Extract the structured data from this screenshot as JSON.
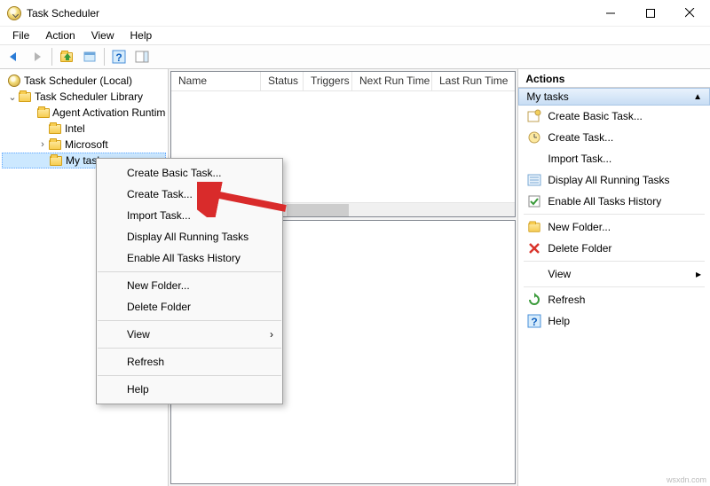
{
  "window": {
    "title": "Task Scheduler"
  },
  "menu": {
    "file": "File",
    "action": "Action",
    "view": "View",
    "help": "Help"
  },
  "tree": {
    "root": "Task Scheduler (Local)",
    "library": "Task Scheduler Library",
    "items": [
      "Agent Activation Runtime",
      "Intel",
      "Microsoft",
      "My tasks"
    ]
  },
  "list": {
    "columns": [
      "Name",
      "Status",
      "Triggers",
      "Next Run Time",
      "Last Run Time"
    ]
  },
  "context_menu": {
    "items": [
      "Create Basic Task...",
      "Create Task...",
      "Import Task...",
      "Display All Running Tasks",
      "Enable All Tasks History",
      "New Folder...",
      "Delete Folder",
      "View",
      "Refresh",
      "Help"
    ]
  },
  "actions": {
    "title": "Actions",
    "group": "My tasks",
    "items": [
      "Create Basic Task...",
      "Create Task...",
      "Import Task...",
      "Display All Running Tasks",
      "Enable All Tasks History",
      "New Folder...",
      "Delete Folder",
      "View",
      "Refresh",
      "Help"
    ]
  },
  "watermark": "wsxdn.com"
}
